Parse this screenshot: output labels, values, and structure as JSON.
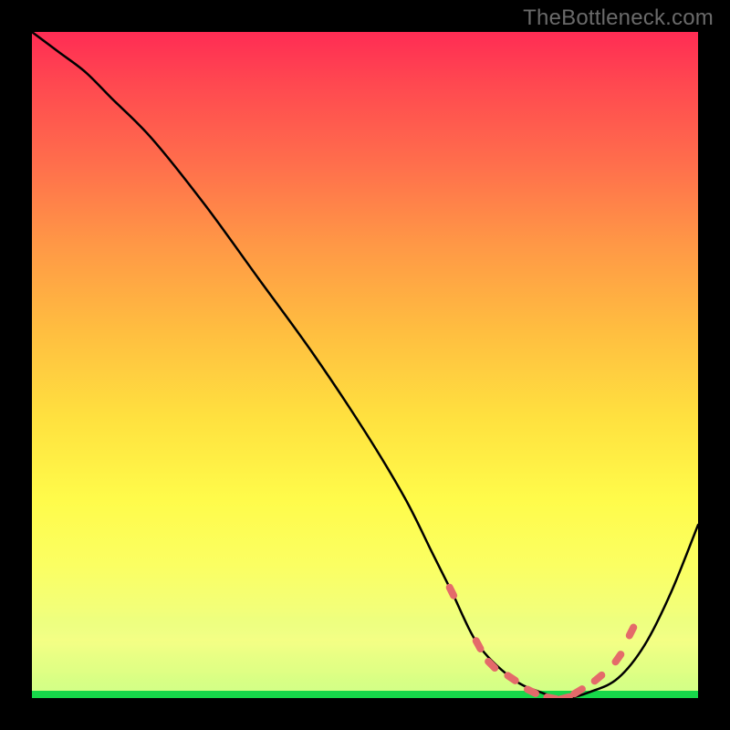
{
  "credit_text": "TheBottleneck.com",
  "colors": {
    "page_bg": "#000000",
    "gradient_top": "#ff2c54",
    "gradient_bottom": "#17d84a",
    "curve": "#000000",
    "marker": "#e46a6a",
    "credit": "#6a6a6a"
  },
  "chart_data": {
    "type": "line",
    "title": "",
    "xlabel": "",
    "ylabel": "",
    "xlim": [
      0,
      100
    ],
    "ylim": [
      0,
      100
    ],
    "grid": false,
    "legend": false,
    "series": [
      {
        "name": "bottleneck-curve",
        "x": [
          0,
          4,
          8,
          12,
          18,
          26,
          34,
          42,
          50,
          56,
          60,
          63,
          67,
          72,
          76,
          80,
          84,
          88,
          92,
          96,
          100
        ],
        "y": [
          100,
          97,
          94,
          90,
          84,
          74,
          63,
          52,
          40,
          30,
          22,
          16,
          8,
          3,
          1,
          0,
          1,
          3,
          8,
          16,
          26
        ]
      }
    ],
    "markers": {
      "name": "highlighted-points",
      "x": [
        63,
        67,
        69,
        72,
        75,
        78,
        80,
        82,
        85,
        88,
        90
      ],
      "y": [
        16,
        8,
        5,
        3,
        1,
        0,
        0,
        1,
        3,
        6,
        10
      ]
    },
    "note": "No axis ticks or labels visible in image; values are relative 0-100 estimates."
  }
}
